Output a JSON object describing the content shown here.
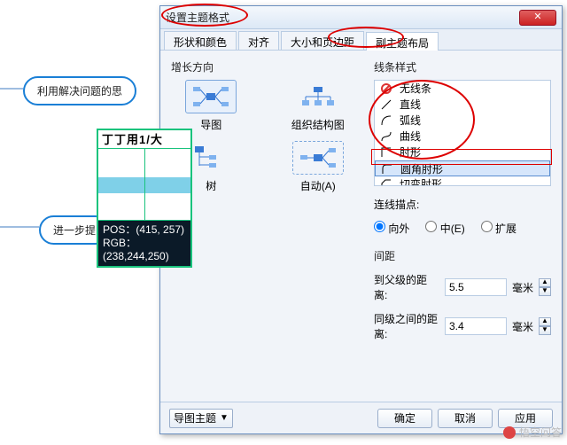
{
  "dialog": {
    "title": "设置主题格式",
    "tabs": [
      "形状和颜色",
      "对齐",
      "大小和页边距",
      "副主题布局"
    ],
    "active_tab": 3,
    "growth": {
      "label": "增长方向",
      "items": [
        {
          "label": "导图"
        },
        {
          "label": "组织结构图"
        },
        {
          "label": "树"
        },
        {
          "label": "自动(A)"
        }
      ]
    },
    "linestyle": {
      "label": "线条样式",
      "items": [
        {
          "label": "无线条"
        },
        {
          "label": "直线"
        },
        {
          "label": "弧线"
        },
        {
          "label": "曲线"
        },
        {
          "label": "肘形"
        },
        {
          "label": "圆角肘形"
        },
        {
          "label": "切变肘形"
        }
      ],
      "selected": 5
    },
    "anchor": {
      "label": "连线描点:",
      "options": [
        "向外",
        "中(E)",
        "扩展"
      ],
      "selected": 0
    },
    "spacing_label": "间距",
    "parent_distance": {
      "label": "到父级的距离:",
      "value": "5.5",
      "unit": "毫米"
    },
    "sibling_distance": {
      "label": "同级之间的距离:",
      "value": "3.4",
      "unit": "毫米"
    },
    "theme_combo": "导图主题",
    "buttons": {
      "ok": "确定",
      "cancel": "取消",
      "apply": "应用"
    }
  },
  "bg": {
    "node1": "利用解决问题的思",
    "node2": "进一步提"
  },
  "inspector": {
    "header": "丁丁用1/大",
    "pos_label": "POS：",
    "pos_value": "(415, 257)",
    "rgb_label": "RGB：",
    "rgb_value": "(238,244,250)"
  },
  "watermark": "悟空问答"
}
